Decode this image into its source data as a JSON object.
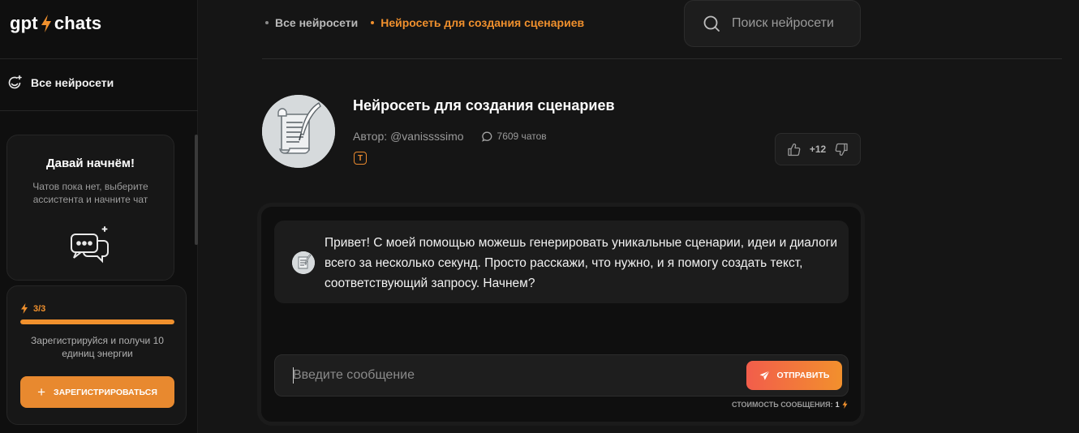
{
  "sidebar": {
    "logo": {
      "left": "gpt",
      "right": "chats"
    },
    "nav_all_label": "Все нейросети",
    "start_card": {
      "title": "Давай начнём!",
      "text": "Чатов пока нет, выберите ассистента и начните чат"
    },
    "energy": {
      "count": "3/3",
      "fill_fraction": 1.0,
      "text": "Зарегистрируйся и получи 10 единиц энергии",
      "register_label": "ЗАРЕГИСТРИРОВАТЬСЯ"
    }
  },
  "header": {
    "breadcrumbs": [
      {
        "label": "Все нейросети"
      },
      {
        "label": "Нейросеть для создания сценариев"
      }
    ],
    "search_placeholder": "Поиск нейросети"
  },
  "bot": {
    "title": "Нейросеть для создания сценариев",
    "author": "Автор: @vanissssimo",
    "chats": "7609 чатов",
    "badge": "T",
    "rating": "+12"
  },
  "chat": {
    "message": "Привет! С моей помощью можешь генерировать уникальные сценарии, идеи и диалоги всего за несколько секунд. Просто расскажи, что нужно, и я помогу создать текст, соответствующий запросу. Начнем?",
    "input_placeholder": "Введите сообщение",
    "send_label": "ОТПРАВИТЬ",
    "cost_label": "СТОИМОСТЬ СООБЩЕНИЯ:",
    "cost_value": "1"
  },
  "colors": {
    "accent": "#e8892f",
    "background": "#151515",
    "sidebar": "#0f0f0f"
  }
}
